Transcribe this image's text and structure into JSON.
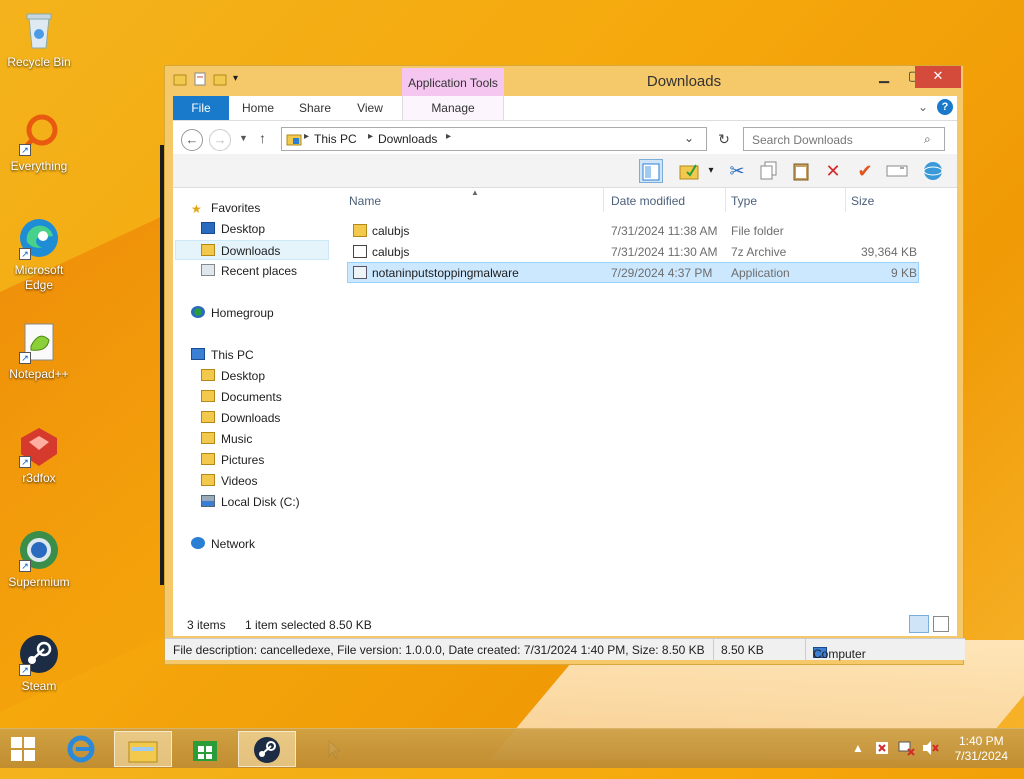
{
  "desktop": {
    "icons": [
      {
        "label": "Recycle Bin"
      },
      {
        "label": "Everything"
      },
      {
        "label": "Microsoft Edge"
      },
      {
        "label": "Notepad++"
      },
      {
        "label": "r3dfox"
      },
      {
        "label": "Supermium"
      },
      {
        "label": "Steam"
      }
    ]
  },
  "window": {
    "title": "Downloads",
    "contextual_tab_group": "Application Tools",
    "tabs": {
      "file": "File",
      "home": "Home",
      "share": "Share",
      "view": "View",
      "manage": "Manage"
    },
    "address": {
      "crumbs": [
        "This PC",
        "Downloads"
      ]
    },
    "search": {
      "placeholder": "Search Downloads"
    },
    "nav": {
      "favorites": "Favorites",
      "favorites_items": [
        "Desktop",
        "Downloads",
        "Recent places"
      ],
      "homegroup": "Homegroup",
      "this_pc": "This PC",
      "this_pc_items": [
        "Desktop",
        "Documents",
        "Downloads",
        "Music",
        "Pictures",
        "Videos",
        "Local Disk (C:)"
      ],
      "network": "Network"
    },
    "columns": {
      "name": "Name",
      "date": "Date modified",
      "type": "Type",
      "size": "Size"
    },
    "files": [
      {
        "name": "calubjs",
        "date": "7/31/2024 11:38 AM",
        "type": "File folder",
        "size": ""
      },
      {
        "name": "calubjs",
        "date": "7/31/2024 11:30 AM",
        "type": "7z Archive",
        "size": "39,364 KB"
      },
      {
        "name": "notaninputstoppingmalware",
        "date": "7/29/2024 4:37 PM",
        "type": "Application",
        "size": "9 KB"
      }
    ],
    "status": {
      "items": "3 items",
      "selected": "1 item selected  8.50 KB"
    },
    "details": {
      "description": "File description: cancelledexe, File version: 1.0.0.0, Date created: 7/31/2024 1:40 PM, Size: 8.50 KB",
      "size": "8.50 KB",
      "location": "Computer"
    }
  },
  "taskbar": {
    "clock_time": "1:40 PM",
    "clock_date": "7/31/2024"
  },
  "colors": {
    "accent": "#1979ca",
    "selection": "#cce8ff",
    "close": "#d44a3b"
  }
}
